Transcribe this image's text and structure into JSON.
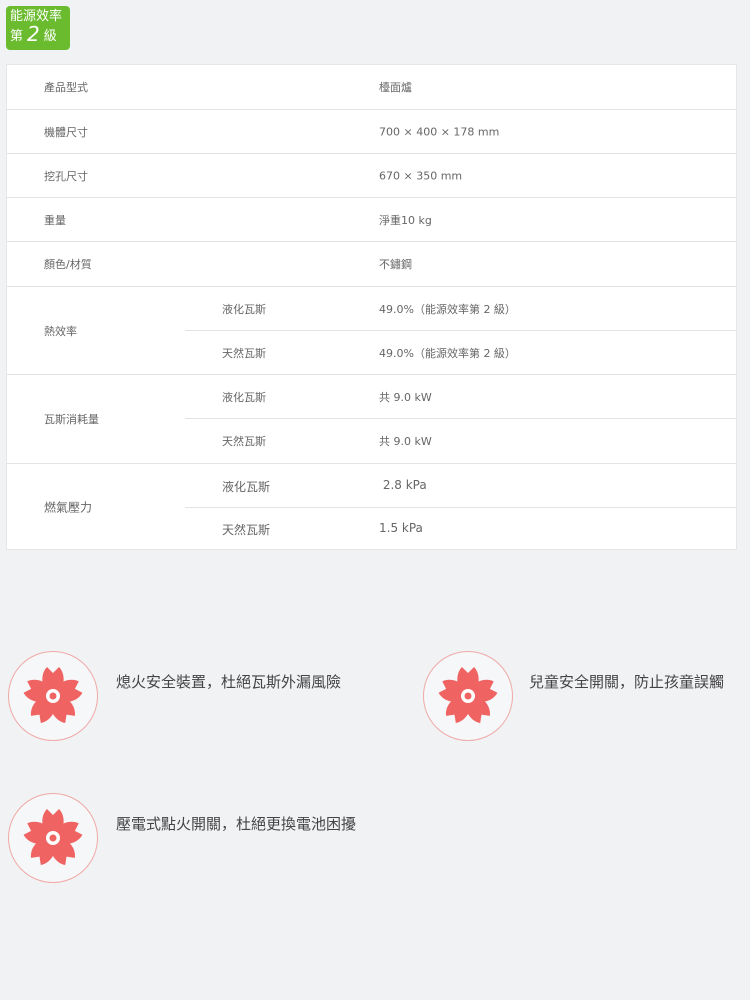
{
  "badge": {
    "line1": "能源效率",
    "prefix": "第",
    "grade": "2",
    "suffix": "級"
  },
  "specs": {
    "rows": [
      {
        "label": "產品型式",
        "value": "檯面爐"
      },
      {
        "label": "機體尺寸",
        "value": "700 × 400 × 178 mm"
      },
      {
        "label": "挖孔尺寸",
        "value": "670 × 350 mm"
      },
      {
        "label": "重量",
        "value": "淨重10 kg"
      },
      {
        "label": "顏色/材質",
        "value": "不鏽鋼"
      }
    ],
    "groups": [
      {
        "label": "熱效率",
        "items": [
          {
            "sub": "液化瓦斯",
            "value": "49.0%（能源效率第 2 級）"
          },
          {
            "sub": "天然瓦斯",
            "value": "49.0%（能源效率第 2 級）"
          }
        ]
      },
      {
        "label": "瓦斯消耗量",
        "items": [
          {
            "sub": "液化瓦斯",
            "value": "共 9.0 kW"
          },
          {
            "sub": "天然瓦斯",
            "value": "共 9.0 kW"
          }
        ]
      },
      {
        "label": "燃氣壓力",
        "items": [
          {
            "sub": "液化瓦斯",
            "value": " 2.8 kPa"
          },
          {
            "sub": "天然瓦斯",
            "value": "1.5 kPa"
          }
        ]
      }
    ]
  },
  "features": [
    {
      "text": "熄火安全裝置，杜絕瓦斯外漏風險",
      "icon": "sakura-icon"
    },
    {
      "text": "兒童安全開關，防止孩童誤觸",
      "icon": "sakura-icon"
    },
    {
      "text": "壓電式點火開關，杜絕更換電池困擾",
      "icon": "sakura-icon"
    }
  ],
  "colors": {
    "badge": "#6bbb2e",
    "flower": "#ef6462",
    "circle_border": "#f0a9a6"
  }
}
